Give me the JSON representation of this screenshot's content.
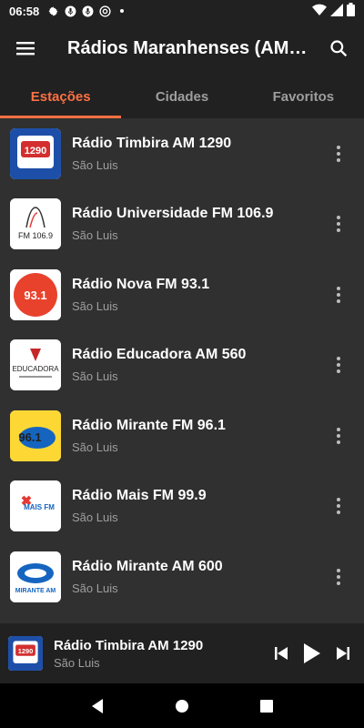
{
  "status": {
    "time": "06:58"
  },
  "appbar": {
    "title": "Rádios Maranhenses (AM e FM)"
  },
  "tabs": [
    {
      "label": "Estações",
      "active": true
    },
    {
      "label": "Cidades",
      "active": false
    },
    {
      "label": "Favoritos",
      "active": false
    }
  ],
  "stations": [
    {
      "name": "Rádio Timbira AM 1290",
      "city": "São Luis",
      "logo": "timbira-logo",
      "logo_text": "1290"
    },
    {
      "name": "Rádio Universidade FM 106.9",
      "city": "São Luis",
      "logo": "universidade-logo",
      "logo_text": "FM 106.9"
    },
    {
      "name": "Rádio Nova FM 93.1",
      "city": "São Luis",
      "logo": "nova-logo",
      "logo_text": "93.1"
    },
    {
      "name": "Rádio Educadora AM 560",
      "city": "São Luis",
      "logo": "educadora-logo",
      "logo_text": "EDUCADORA"
    },
    {
      "name": "Rádio Mirante FM 96.1",
      "city": "São Luis",
      "logo": "mirante-fm-logo",
      "logo_text": "96.1"
    },
    {
      "name": "Rádio Mais FM 99.9",
      "city": "São Luis",
      "logo": "mais-fm-logo",
      "logo_text": "MAIS FM"
    },
    {
      "name": "Rádio Mirante AM 600",
      "city": "São Luis",
      "logo": "mirante-am-logo",
      "logo_text": "MIRANTE AM"
    }
  ],
  "player": {
    "title": "Rádio Timbira AM 1290",
    "subtitle": "São Luis",
    "logo_text": "1290"
  },
  "colors": {
    "accent": "#ff7043",
    "appbar": "#212121",
    "list_bg": "#303030"
  }
}
